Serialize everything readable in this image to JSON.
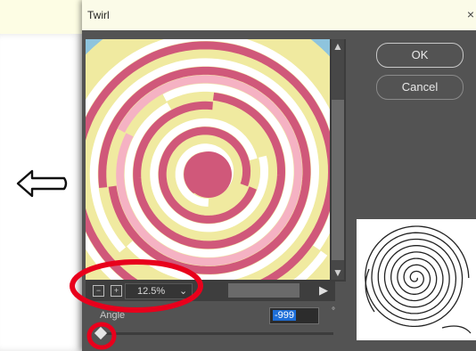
{
  "dialog": {
    "title": "Twirl",
    "close_glyph": "×",
    "ok_label": "OK",
    "cancel_label": "Cancel"
  },
  "preview": {
    "zoom_out_glyph": "−",
    "zoom_in_glyph": "+",
    "zoom_value": "12.5%",
    "zoom_dropdown_glyph": "⌄",
    "scroll_up_glyph": "▲",
    "scroll_down_glyph": "▼",
    "scroll_right_glyph": "▶"
  },
  "angle": {
    "label": "Angle",
    "value": "-999",
    "unit": "°"
  },
  "icons": {
    "arrow": "left-arrow-doodle-icon",
    "spiral": "spiral-reference-icon"
  },
  "colors": {
    "dialog_bg": "#535353",
    "swirl_pink": "#d0587a",
    "swirl_light_pink": "#f5b2c3",
    "swirl_yellow": "#f0eaa0",
    "swirl_blue": "#8ec4dd",
    "annotation_red": "#e8001c"
  }
}
